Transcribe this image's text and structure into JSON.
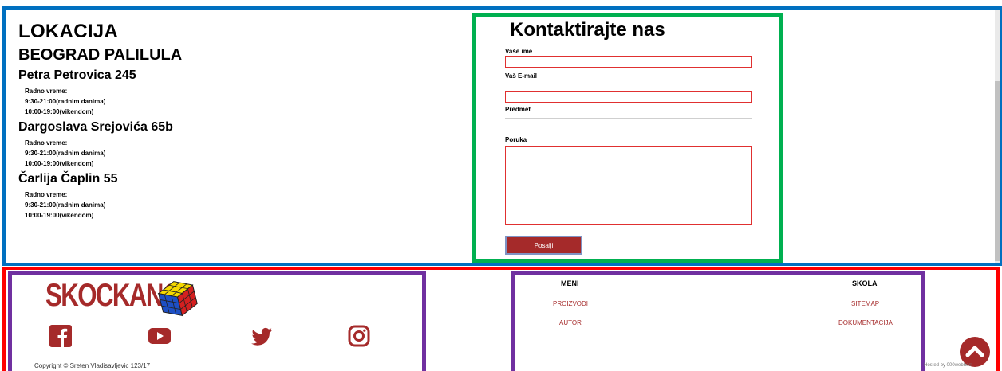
{
  "location": {
    "title": "LOKACIJA",
    "city": "BEOGRAD PALILULA",
    "branches": [
      {
        "name": "Petra Petrovica 245",
        "label": "Radno vreme:",
        "weekdays": "9:30-21:00(radnim danima)",
        "weekend": "10:00-19:00(vikendom)"
      },
      {
        "name": "Dargoslava Srejovića 65b",
        "label": "Radno vreme:",
        "weekdays": "9:30-21:00(radnim danima)",
        "weekend": "10:00-19:00(vikendom)"
      },
      {
        "name": "Čarlija Čaplin 55",
        "label": "Radno vreme:",
        "weekdays": "9:30-21:00(radnim danima)",
        "weekend": "10:00-19:00(vikendom)"
      }
    ]
  },
  "contact": {
    "title": "Kontaktirajte nas",
    "name_label": "Vaše ime",
    "email_label": "Vaš E-mail",
    "subject_label": "Predmet",
    "message_label": "Poruka",
    "submit_label": "Posalji"
  },
  "footer": {
    "logo_text": "SKOCKANO",
    "social_icons": [
      "facebook-icon",
      "youtube-icon",
      "twitter-icon",
      "instagram-icon"
    ],
    "copyright": "Copyright © Sreten Vladisavljevic 123/17",
    "menu": {
      "heading": "MENI",
      "links": [
        "PROIZVODI",
        "AUTOR"
      ]
    },
    "school": {
      "heading": "SKOLA",
      "links": [
        "SITEMAP",
        "DOKUMENTACIJA"
      ]
    },
    "hosted_by": "Hosted by 000webhost"
  },
  "colors": {
    "accent": "#a52a2a",
    "top_border": "#0070c0",
    "contact_border": "#00b050",
    "footer_border": "#ff0000",
    "panel_border": "#7030a0"
  }
}
